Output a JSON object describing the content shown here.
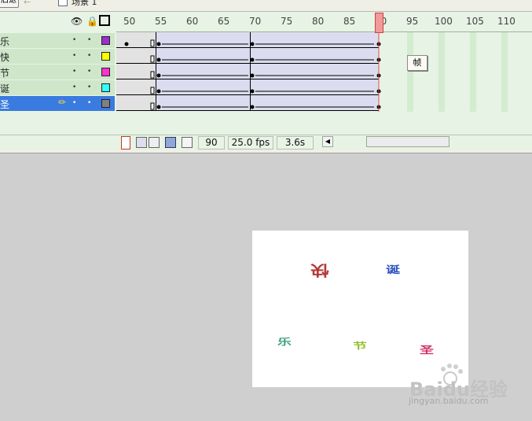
{
  "top_bar": {
    "back_label": "后退",
    "scene_label": "场景 1"
  },
  "timeline": {
    "ruler_ticks": [
      "50",
      "55",
      "60",
      "65",
      "70",
      "75",
      "80",
      "85",
      "90",
      "95",
      "100",
      "105",
      "110"
    ],
    "playhead_frame": "90",
    "layers": [
      {
        "name": "乐",
        "color": "#9b2fd0"
      },
      {
        "name": "快",
        "color": "#ffff00"
      },
      {
        "name": "节",
        "color": "#ff33cc"
      },
      {
        "name": "诞",
        "color": "#33ffff"
      },
      {
        "name": "圣",
        "color": "#808080",
        "selected": true
      }
    ],
    "current_frame": "90",
    "fps": "25.0 fps",
    "elapsed": "3.6s",
    "tooltip": "帧",
    "colors": {
      "selected": "#3a7be0",
      "playhead": "#e05050",
      "panel": "#e7f3e4"
    }
  },
  "stage": {
    "glyphs": [
      {
        "char": "快",
        "color": "#b33a3a"
      },
      {
        "char": "诞",
        "color": "#2a4fc0"
      },
      {
        "char": "乐",
        "color": "#3aa07a"
      },
      {
        "char": "节",
        "color": "#8fbf2a"
      },
      {
        "char": "圣",
        "color": "#d0306a"
      }
    ]
  },
  "watermark": {
    "logo": "Baidu经验",
    "url": "jingyan.baidu.com"
  }
}
